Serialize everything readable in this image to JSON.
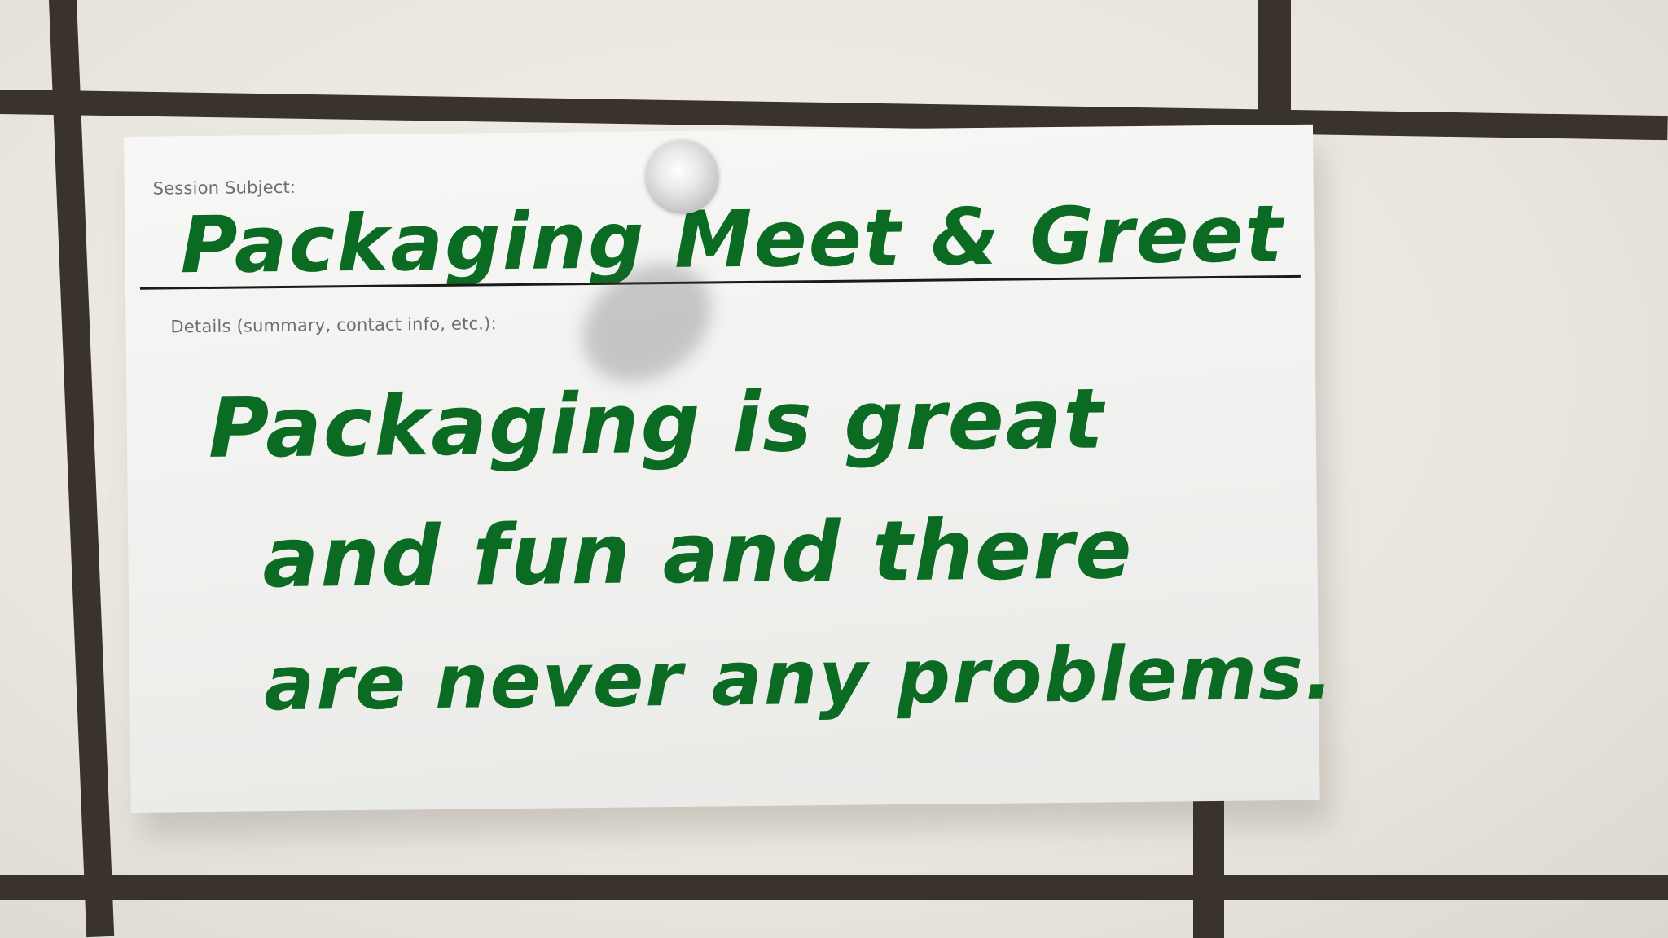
{
  "card": {
    "subject_label": "Session Subject:",
    "subject_text": "Packaging Meet & Greet",
    "details_label": "Details (summary, contact info, etc.):",
    "details_lines": [
      "Packaging is great",
      "and fun and there",
      "are never any problems."
    ]
  },
  "colors": {
    "ink": "#0b6b22",
    "grid_line": "#3a322c",
    "card": "#f4f4f2",
    "background": "#ece9e2"
  },
  "icons": [
    "push-pin-icon"
  ]
}
